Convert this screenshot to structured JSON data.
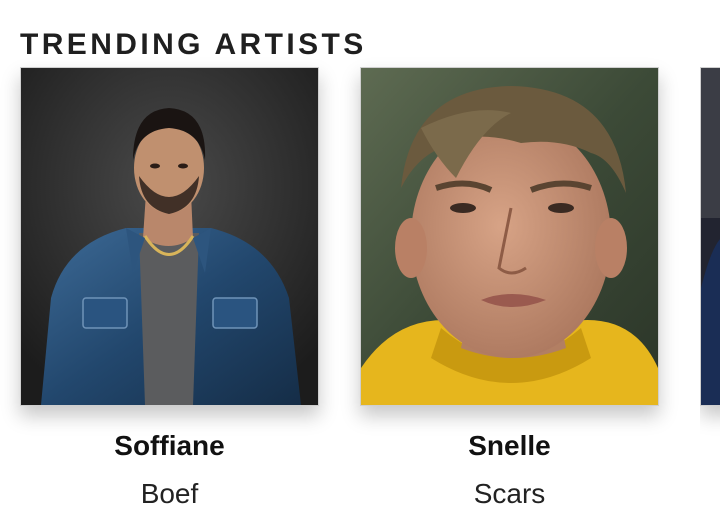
{
  "section": {
    "title": "TRENDING ARTISTS"
  },
  "artists": [
    {
      "name": "Soffiane",
      "track": "Boef",
      "photo": "artist-photo-denim-jacket"
    },
    {
      "name": "Snelle",
      "track": "Scars",
      "photo": "artist-photo-yellow-hoodie"
    },
    {
      "name": "",
      "track": "",
      "photo": "artist-photo-partial"
    }
  ],
  "colors": {
    "title": "#1f1f1f",
    "name": "#111111",
    "track": "#222222",
    "card_border": "#cfcfcf"
  }
}
